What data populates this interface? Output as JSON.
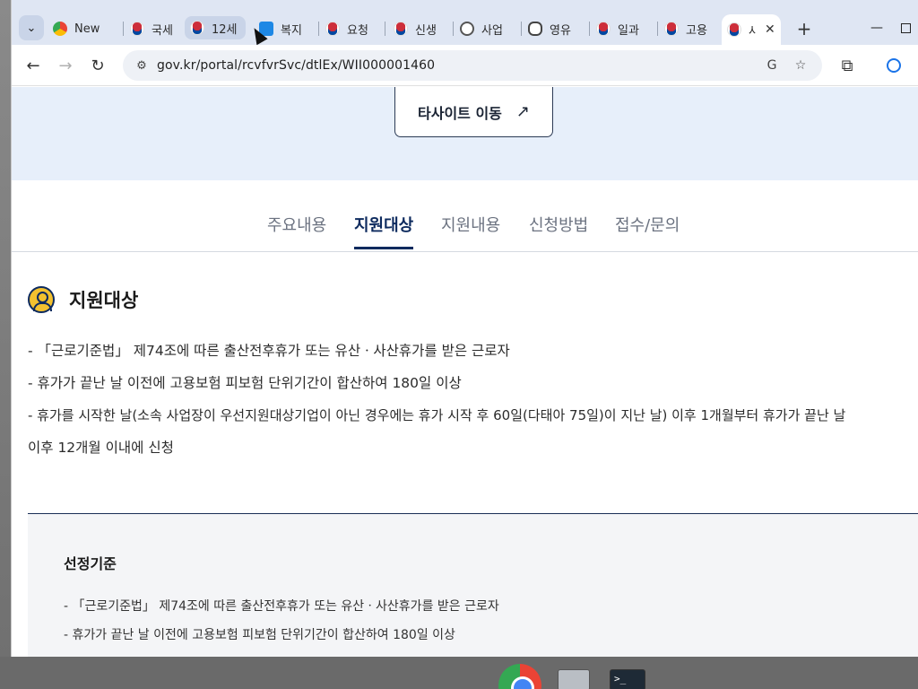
{
  "browser": {
    "tabs": [
      {
        "label": "New",
        "favicon": "chrome",
        "state": "normal"
      },
      {
        "label": "국세",
        "favicon": "gov-kr",
        "state": "normal"
      },
      {
        "label": "12세",
        "favicon": "gov-kr",
        "state": "hover"
      },
      {
        "label": "복지",
        "favicon": "welfare",
        "state": "normal"
      },
      {
        "label": "요청",
        "favicon": "gov-kr",
        "state": "normal"
      },
      {
        "label": "신생",
        "favicon": "gov-kr",
        "state": "normal"
      },
      {
        "label": "사업",
        "favicon": "globe",
        "state": "normal"
      },
      {
        "label": "영유",
        "favicon": "youth",
        "state": "normal"
      },
      {
        "label": "일과",
        "favicon": "gov-kr",
        "state": "normal"
      },
      {
        "label": "고용",
        "favicon": "gov-kr",
        "state": "normal"
      },
      {
        "label": "사",
        "favicon": "gov-kr",
        "state": "active"
      }
    ],
    "close_glyph": "✕",
    "new_tab_glyph": "+",
    "url": "gov.kr/portal/rcvfvrSvc/dtlEx/WII000001460"
  },
  "page": {
    "external_button": {
      "label": "타사이트 이동",
      "arrow": "↗"
    },
    "tabs": [
      {
        "label": "주요내용",
        "selected": false
      },
      {
        "label": "지원대상",
        "selected": true
      },
      {
        "label": "지원내용",
        "selected": false
      },
      {
        "label": "신청방법",
        "selected": false
      },
      {
        "label": "접수/문의",
        "selected": false
      }
    ],
    "section_title": "지원대상",
    "lines": [
      "- 「근로기준법」 제74조에 따른 출산전후휴가 또는 유산ㆍ사산휴가를 받은 근로자",
      "- 휴가가 끝난 날 이전에 고용보험 피보험 단위기간이 합산하여 180일 이상",
      "- 휴가를 시작한 날(소속 사업장이 우선지원대상기업이 아닌 경우에는 휴가 시작 후 60일(다태아 75일)이 지난 날) 이후 1개월부터 휴가가 끝난 날",
      "이후 12개월 이내에 신청"
    ],
    "criteria": {
      "title": "선정기준",
      "lines": [
        "- 「근로기준법」 제74조에 따른 출산전후휴가 또는 유산ㆍ사산휴가를 받은 근로자",
        "- 휴가가 끝난 날 이전에 고용보험 피보험 단위기간이 합산하여 180일 이상"
      ]
    }
  },
  "taskbar": {
    "terminal_label": ">_"
  },
  "colors": {
    "tabstrip": "#dfe6f3",
    "hero": "#e7effa",
    "accent_navy": "#0d2a5e"
  }
}
